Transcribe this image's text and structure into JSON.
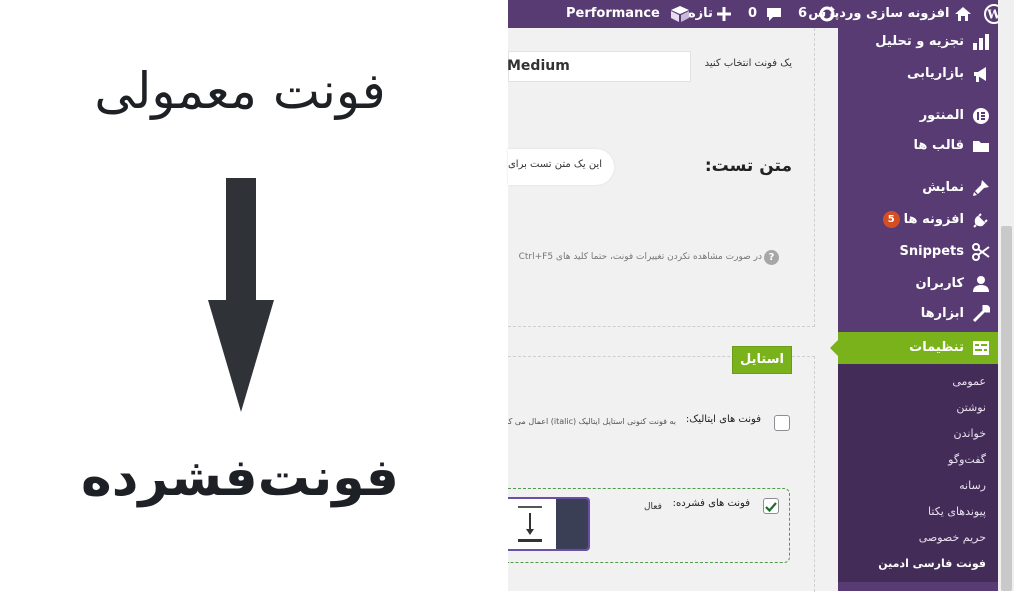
{
  "illustration": {
    "normal_title": "فونت معمولی",
    "condensed_title": "فونت‌فشرده"
  },
  "admin_bar": {
    "site_name": "افزونه سازی وردپرس",
    "updates_count": "6",
    "comments_count": "0",
    "new_label": "تازه",
    "performance_label": "Performance"
  },
  "content": {
    "font_select_label": "یک فونت انتخاب کنید",
    "font_select_value": "Medium",
    "test_text_label": "متن تست:",
    "test_text_value": "این یک متن تست برای ا",
    "help_note": "در صورت مشاهده نکردن تغییرات فونت، حتما کلید های Ctrl+F5",
    "style_section_label": "استایل",
    "italic_label": "فونت های ایتالیک:",
    "italic_desc": "به فونت کنونی استایل ایتالیک (italic) اعمال می کند.",
    "condensed_label": "فونت های فشرده:",
    "condensed_status": "فعال",
    "italic_checked": false,
    "condensed_checked": true
  },
  "sidebar": {
    "items": [
      {
        "label": "تجزیه و تحلیل",
        "icon": "chart-bar-icon"
      },
      {
        "label": "بازاریابی",
        "icon": "megaphone-icon"
      },
      {
        "label": "المنتور",
        "icon": "elementor-icon"
      },
      {
        "label": "قالب ها",
        "icon": "folder-icon"
      },
      {
        "label": "نمایش",
        "icon": "brush-icon"
      },
      {
        "label": "افزونه ها",
        "icon": "plugin-icon",
        "badge": "5"
      },
      {
        "label": "Snippets",
        "icon": "scissors-icon"
      },
      {
        "label": "کاربران",
        "icon": "user-icon"
      },
      {
        "label": "ابزارها",
        "icon": "wrench-icon"
      },
      {
        "label": "تنظیمات",
        "icon": "settings-icon",
        "active": true
      }
    ],
    "submenu": [
      "عمومی",
      "نوشتن",
      "خواندن",
      "گفت‌وگو",
      "رسانه",
      "پیوندهای یکتا",
      "حریم خصوصی",
      "فونت فارسی ادمین"
    ]
  },
  "colors": {
    "brand_purple": "#583b73",
    "active_green": "#7ab21c",
    "badge_orange": "#d54e21"
  }
}
